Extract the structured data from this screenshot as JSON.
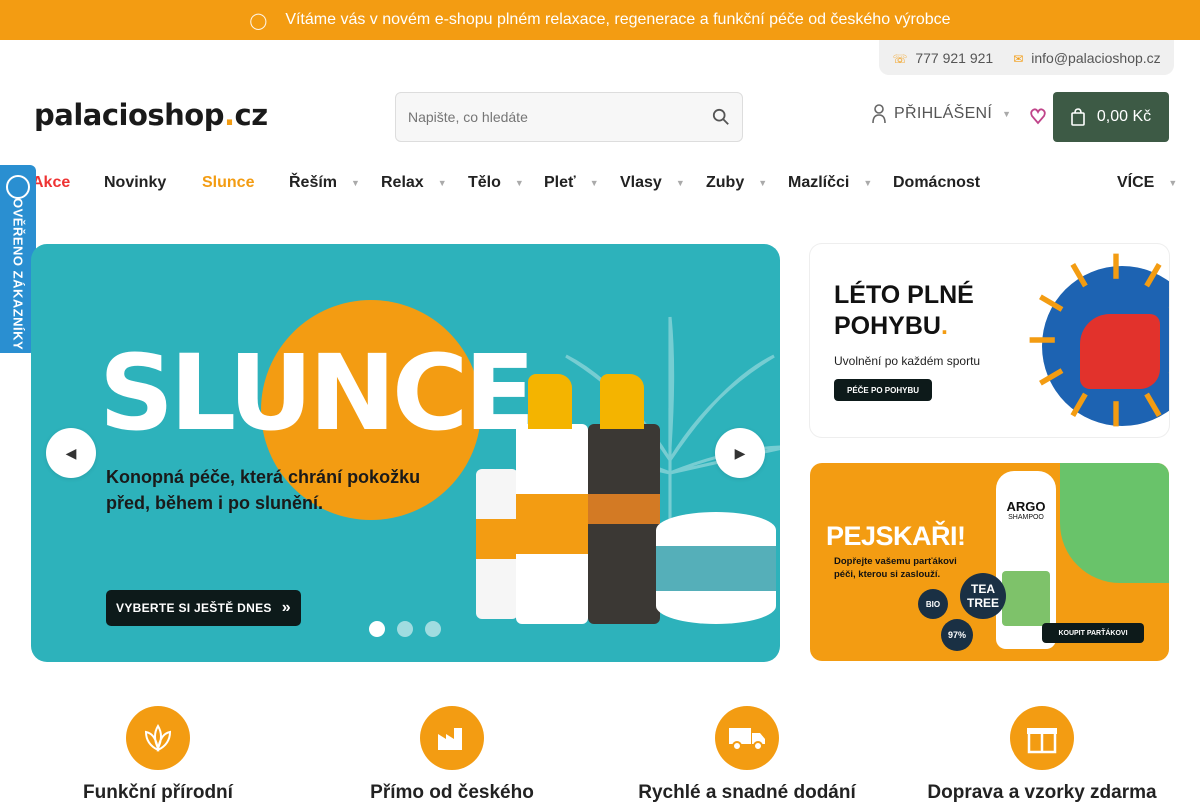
{
  "announcement": {
    "icon": "info-icon",
    "text": "Vítáme vás v novém e-shopu plném relaxace, regenerace a funkční péče od českého výrobce"
  },
  "contact": {
    "phone": "777 921 921",
    "email": "info@palacioshop.cz"
  },
  "logo": {
    "main": "palacioshop",
    "dot": ".",
    "tld": "cz"
  },
  "search": {
    "placeholder": "Napište, co hledáte"
  },
  "account": {
    "login_label": "PŘIHLÁŠENÍ"
  },
  "cart": {
    "total": "0,00 Kč"
  },
  "nav": {
    "items": [
      "Akce",
      "Novinky",
      "Slunce",
      "Řeším",
      "Relax",
      "Tělo",
      "Pleť",
      "Vlasy",
      "Zuby",
      "Mazlíčci",
      "Domácnost"
    ],
    "more": "VÍCE"
  },
  "badge": {
    "text": "OVĚŘENO ZÁKAZNÍKY"
  },
  "hero": {
    "title": "SLUNCE",
    "title_dot": ".",
    "subtitle": "Konopná péče, která chrání pokožku před, během i po slunění.",
    "cta": "VYBERTE SI JEŠTĚ DNES",
    "slides": 3,
    "active_slide": 1
  },
  "banner_sport": {
    "title_line1": "LÉTO PLNÉ",
    "title_line2": "POHYBU",
    "dot": ".",
    "subtitle": "Uvolnění po každém sportu",
    "button": "PÉČE PO POHYBU"
  },
  "banner_dogs": {
    "title": "PEJSKAŘI!",
    "subtitle": "Dopřejte vašemu parťákovi péči, kterou si zaslouží.",
    "bottle_brand": "ARGO",
    "bottle_label": "SHAMPOO",
    "badge_tea": "TEA TREE",
    "badge_bio": "BIO",
    "badge_pct": "97%",
    "button": "KOUPIT PARŤÁKOVI"
  },
  "features": [
    {
      "icon": "leaf-icon",
      "label": "Funkční přírodní"
    },
    {
      "icon": "factory-icon",
      "label": "Přímo od českého"
    },
    {
      "icon": "truck-icon",
      "label": "Rychlé a snadné dodání"
    },
    {
      "icon": "gift-icon",
      "label": "Doprava a vzorky zdarma"
    }
  ],
  "colors": {
    "accent": "#f39c12",
    "cart": "#3d5a45",
    "hero_bg": "#2db2bb",
    "sale": "#e33333"
  }
}
